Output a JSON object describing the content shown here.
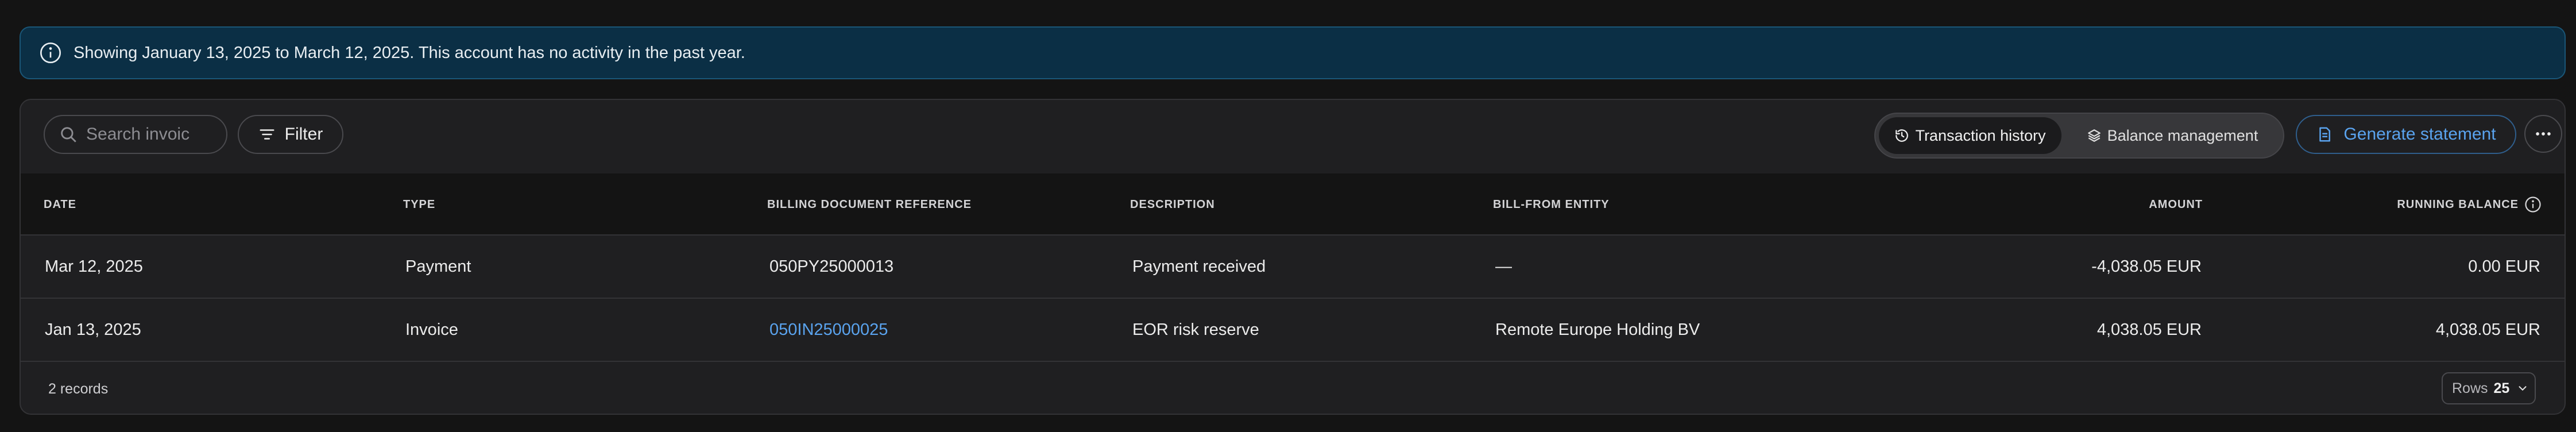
{
  "banner": {
    "text": "Showing January 13, 2025 to March 12, 2025. This account has no activity in the past year.",
    "icon": "info-icon"
  },
  "toolbar": {
    "search_placeholder": "Search invoic",
    "search_value": "",
    "filter_label": "Filter",
    "tabs": [
      {
        "label": "Transaction history",
        "icon": "history-icon",
        "active": true
      },
      {
        "label": "Balance management",
        "icon": "layers-icon",
        "active": false
      }
    ],
    "generate_label": "Generate statement",
    "more_icon": "more-horizontal-icon"
  },
  "table": {
    "columns": [
      "DATE",
      "TYPE",
      "BILLING DOCUMENT REFERENCE",
      "DESCRIPTION",
      "BILL-FROM ENTITY",
      "AMOUNT",
      "RUNNING BALANCE"
    ],
    "rows": [
      {
        "date": "Mar 12, 2025",
        "type": "Payment",
        "reference": "050PY25000013",
        "description": "Payment received",
        "entity": "—",
        "amount": "-4,038.05 EUR",
        "balance": "0.00 EUR"
      },
      {
        "date": "Jan 13, 2025",
        "type": "Invoice",
        "reference": "050IN25000025",
        "description": "EOR risk reserve",
        "entity": "Remote Europe Holding BV",
        "amount": "4,038.05 EUR",
        "balance": "4,038.05 EUR"
      }
    ]
  },
  "footer": {
    "records": "2 records",
    "rows_label": "Rows",
    "rows_value": "25"
  },
  "colors": {
    "banner_bg": "#0b2f45",
    "accent_link": "#5aa3ee",
    "page_bg": "#141414",
    "panel_bg": "#1f1f21"
  }
}
